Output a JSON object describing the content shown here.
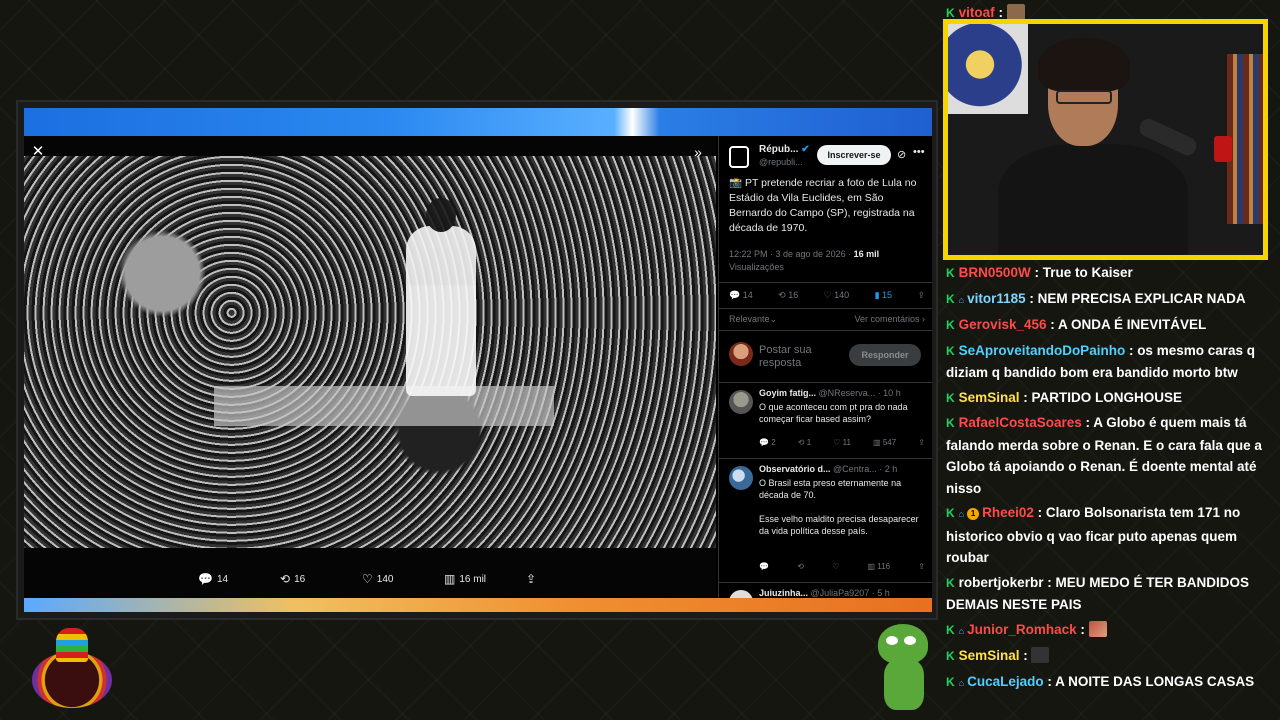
{
  "tweet": {
    "account_name": "Répub...",
    "account_handle": "@republi...",
    "subscribe_label": "Inscrever-se",
    "text": "📸 PT pretende recriar a foto de Lula no Estádio da Vila Euclides, em São Bernardo do Campo (SP), registrada na década de 1970.",
    "time": "12:22 PM · 3 de ago de 2026 ·",
    "views": "16 mil",
    "views_label": "Visualizações",
    "replies": "14",
    "reposts": "16",
    "likes": "140",
    "bookmarks": "15",
    "sort_label": "Relevante",
    "see_replies": "Ver comentários"
  },
  "photo_actions": {
    "replies": "14",
    "reposts": "16",
    "likes": "140",
    "views": "16 mil",
    "colors": {
      "text": "#e7e9ea"
    }
  },
  "reply_box": {
    "placeholder": "Postar sua resposta",
    "button": "Responder"
  },
  "replies": [
    {
      "name": "Goyim fatig...",
      "handle": "@NReserva... · 10 h",
      "text": "O que aconteceu com pt pra do nada começar ficar based assim?",
      "replies": "2",
      "reposts": "1",
      "likes": "11",
      "views": "547"
    },
    {
      "name": "Observatório d...",
      "handle": "@Centra... · 2 h",
      "text": "O Brasil esta preso eternamente na década de 70.\n\nEsse velho maldito precisa desaparecer da vida política desse país.",
      "replies": "",
      "reposts": "",
      "likes": "",
      "views": "116"
    },
    {
      "name": "Juiuzinha...",
      "handle": "@JuliaPa9207 · 5 h",
      "text": "",
      "replies": "",
      "reposts": "",
      "likes": "",
      "views": ""
    }
  ],
  "chat_top": {
    "user": "vitoaf",
    "sep": " :"
  },
  "chat": [
    {
      "user": "BRN0500W",
      "color": "#ff4a4a",
      "sub": false,
      "coin": "",
      "text": "True to Kaiser"
    },
    {
      "user": "vitor1185",
      "color": "#7fd7ff",
      "sub": true,
      "coin": "",
      "text": "NEM PRECISA EXPLICAR NADA"
    },
    {
      "user": "Gerovisk_456",
      "color": "#ff4a4a",
      "sub": false,
      "coin": "",
      "text": "A ONDA É INEVITÁVEL"
    },
    {
      "user": "SeAproveitandoDoPainho",
      "color": "#4fd0ff",
      "sub": false,
      "coin": "",
      "text": "os mesmo caras q diziam q bandido bom era bandido morto btw"
    },
    {
      "user": "SemSinal",
      "color": "#ffe14a",
      "sub": false,
      "coin": "",
      "text": "PARTIDO LONGHOUSE"
    },
    {
      "user": "RafaelCostaSoares",
      "color": "#ff4a4a",
      "sub": false,
      "coin": "",
      "text": "A Globo é quem mais tá falando merda sobre o Renan. E o cara fala que a Globo tá apoiando o Renan. É doente mental até nisso"
    },
    {
      "user": "Rheei02",
      "color": "#ff4a4a",
      "sub": true,
      "coin": "1",
      "text": "Claro Bolsonarista tem 171 no historico obvio q vao ficar puto apenas quem roubar"
    },
    {
      "user": "robertjokerbr",
      "color": "#ffffff",
      "sub": false,
      "coin": "",
      "text": "MEU MEDO É TER BANDIDOS DEMAIS NESTE PAIS"
    },
    {
      "user": "Junior_Romhack",
      "color": "#ff4a4a",
      "sub": true,
      "coin": "",
      "text": ""
    },
    {
      "user": "SemSinal",
      "color": "#ffe14a",
      "sub": false,
      "coin": "",
      "text": ""
    },
    {
      "user": "CucaLejado",
      "color": "#4fd0ff",
      "sub": true,
      "coin": "",
      "text": "A NOITE DAS LONGAS CASAS"
    }
  ]
}
